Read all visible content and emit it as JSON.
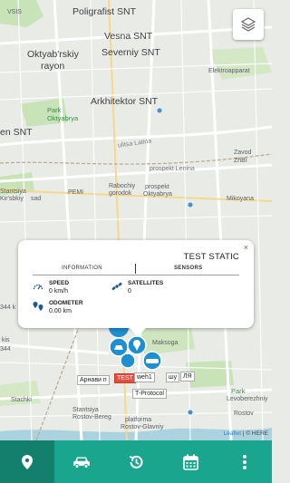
{
  "map": {
    "labels": {
      "vsis": "VSIS",
      "poligrafist": "Poligrafist SNT",
      "vesna": "Vesna SNT",
      "oktyabrskiy": "Oktyab'rskiy",
      "rayon": "rayon",
      "severniy": "Severniy SNT",
      "elektroapparat": "Elektroapparat",
      "arkhitektor": "Arkhitektor SNT",
      "park": "Park",
      "oktyabrya": "Oktyabrya",
      "en_snt": "en SNT",
      "ulitsa_latina": "ulitsa Latina",
      "prospekt_lenina": "prospekt Lenina",
      "zavod": "Zavod",
      "zhbi": "ZhBI",
      "rabochiy": "Rabochiy",
      "gorodok": "gorodok",
      "prospekt": "prospekt",
      "oktyabrya2": "Oktyabrya",
      "pemi": "PEMI",
      "stantsiya": "Stantsiya",
      "kirsbkiy": "Kir'sbkiy",
      "sad": "sad",
      "mikoyana": "Mikoyana",
      "g344": "344 k",
      "kis": "kis",
      "k344b": "344",
      "maksoga": "Maksoga",
      "stachki": "Stachki",
      "stantsiya2": "Stantsiya",
      "rostov_bereg": "Rostov-Bereg",
      "platforma": "platforma",
      "rostov_glavniy": "Rostov-Glavniy",
      "park2": "Park",
      "levoberezhniy": "Levoberezhniy",
      "rostov": "Rostov"
    },
    "attribution": {
      "leaflet": "Leaflet",
      "sep": " | © HERE"
    },
    "layers_icon": "layers-icon"
  },
  "popup": {
    "title": "TEST STATIC",
    "close": "×",
    "tabs": [
      "INFORMATION",
      "SENSORS"
    ],
    "active_tab": "SENSORS",
    "speed": {
      "label": "SPEED",
      "value": "0 km/h"
    },
    "satellites": {
      "label": "SATELLITES",
      "value": "0"
    },
    "odometer": {
      "label": "ODOMETER",
      "value": "0.00 km"
    }
  },
  "markers": {
    "tag_arnavi": "Арнави п",
    "tag_test": "TEST",
    "tag_weh1": "weh1",
    "tag_guy": "ЛЯ",
    "tag_tprotocol": "T-Protocol",
    "tag_ury": "шу"
  },
  "nav": {
    "items": [
      {
        "icon": "map-pin-icon",
        "active": true
      },
      {
        "icon": "car-icon",
        "active": false
      },
      {
        "icon": "history-icon",
        "active": false
      },
      {
        "icon": "calendar-icon",
        "active": false
      },
      {
        "icon": "more-vertical-icon",
        "active": false
      }
    ]
  },
  "colors": {
    "accent": "#1aa58e",
    "accent_dark": "#12806d",
    "marker_blue": "#1f8fd0",
    "marker_red": "#e84b3a",
    "map_bg": "#e9ebe6",
    "park_green": "#c8e3b8"
  }
}
